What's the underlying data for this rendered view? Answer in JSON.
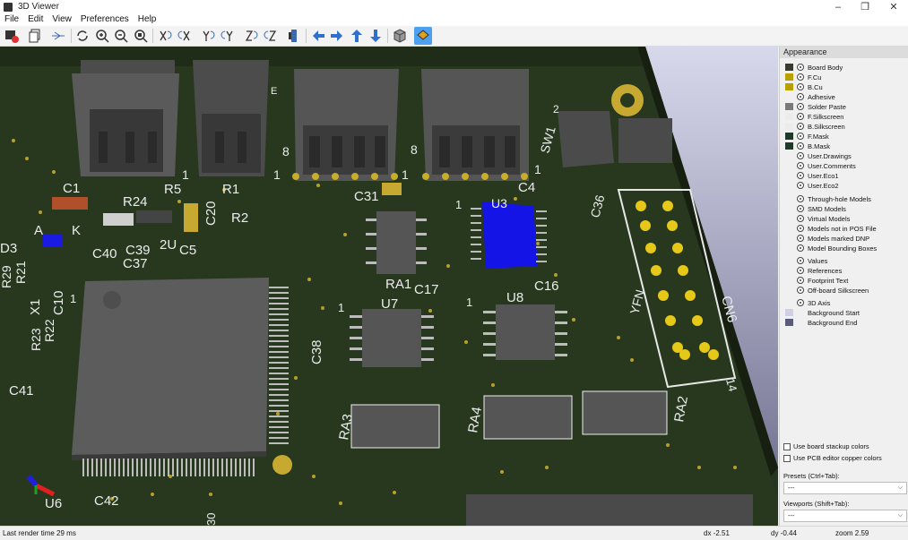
{
  "window": {
    "title": "3D Viewer"
  },
  "menu": [
    "File",
    "Edit",
    "View",
    "Preferences",
    "Help"
  ],
  "toolbar": {
    "icons": [
      "render-icon",
      "copy-icon",
      "ray-trace-icon",
      "reload-icon",
      "zoom-in-icon",
      "zoom-out-icon",
      "zoom-fit-icon",
      "rotate-x-cw-icon",
      "rotate-x-ccw-icon",
      "rotate-y-cw-icon",
      "rotate-y-ccw-icon",
      "rotate-z-cw-icon",
      "rotate-z-ccw-icon",
      "flip-board-icon",
      "pan-left-icon",
      "pan-right-icon",
      "pan-up-icon",
      "pan-down-icon",
      "ortho-icon",
      "layers-panel-icon"
    ]
  },
  "appearance": {
    "title": "Appearance",
    "layers": [
      {
        "label": "Board Body",
        "color": "#3a3a2e"
      },
      {
        "label": "F.Cu",
        "color": "#b8a000"
      },
      {
        "label": "B.Cu",
        "color": "#b8a000"
      },
      {
        "label": "Adhesive",
        "color": ""
      },
      {
        "label": "Solder Paste",
        "color": "#7a7a7a"
      },
      {
        "label": "F.Silkscreen",
        "color": "#ececec"
      },
      {
        "label": "B.Silkscreen",
        "color": "#ececec"
      },
      {
        "label": "F.Mask",
        "color": "#1f3a2a"
      },
      {
        "label": "B.Mask",
        "color": "#1f3a2a"
      },
      {
        "label": "User.Drawings",
        "color": ""
      },
      {
        "label": "User.Comments",
        "color": ""
      },
      {
        "label": "User.Eco1",
        "color": ""
      },
      {
        "label": "User.Eco2",
        "color": ""
      }
    ],
    "models": [
      {
        "label": "Through-hole Models"
      },
      {
        "label": "SMD Models"
      },
      {
        "label": "Virtual Models"
      },
      {
        "label": "Models not in POS File"
      },
      {
        "label": "Models marked DNP"
      },
      {
        "label": "Model Bounding Boxes"
      }
    ],
    "texts": [
      {
        "label": "Values"
      },
      {
        "label": "References"
      },
      {
        "label": "Footprint Text"
      },
      {
        "label": "Off-board Silkscreen"
      }
    ],
    "axis": [
      {
        "label": "3D Axis"
      },
      {
        "label": "Background Start",
        "color": "#cfcfe6"
      },
      {
        "label": "Background End",
        "color": "#5a5a7a"
      }
    ],
    "use_stackup": "Use board stackup colors",
    "use_pcb_copper": "Use PCB editor copper colors",
    "presets_label": "Presets (Ctrl+Tab):",
    "presets_value": "---",
    "viewports_label": "Viewports (Shift+Tab):",
    "viewports_value": "---"
  },
  "status": {
    "render_time": "Last render time 29 ms",
    "dx": "dx -2.51",
    "dy": "dy -0.44",
    "zoom": "zoom 2.59"
  },
  "board": {
    "refs": [
      "C1",
      "R24",
      "R5",
      "R1",
      "R2",
      "C20",
      "C40",
      "C39",
      "C37",
      "C5",
      "2U",
      "D3",
      "A",
      "K",
      "R29",
      "R21",
      "X1",
      "C10",
      "R23",
      "R22",
      "C41",
      "C31",
      "C4",
      "U3",
      "C36",
      "SW1",
      "CN6",
      "YFN",
      "14",
      "RA1",
      "C17",
      "U7",
      "U8",
      "C16",
      "C38",
      "RA3",
      "RA4",
      "RA2",
      "C42",
      "U6",
      "E",
      "8",
      "1",
      "2",
      "30"
    ]
  }
}
